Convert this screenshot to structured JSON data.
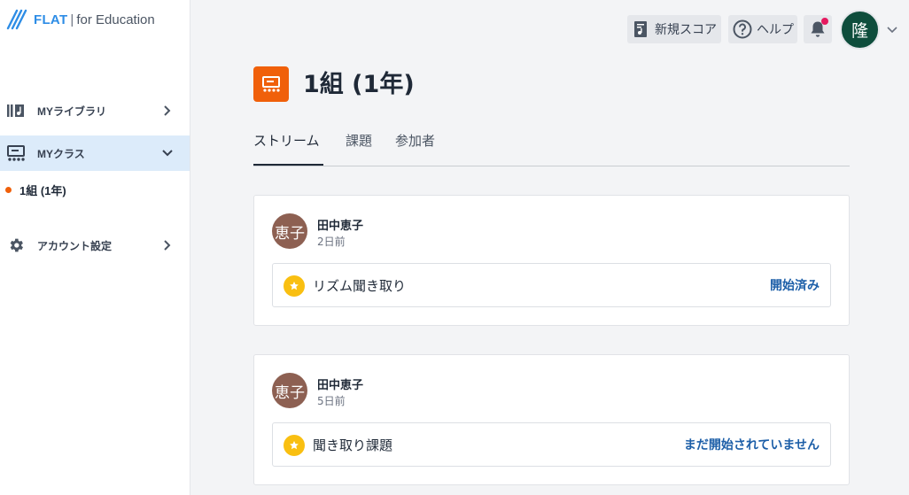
{
  "brand": {
    "name": "FLAT",
    "separator": "|",
    "product": "for Education",
    "color": "#2e8de6"
  },
  "sidebar": {
    "items": [
      {
        "label": "MYライブラリ",
        "icon": "library-icon",
        "chevron": "chevron-right-icon"
      },
      {
        "label": "MYクラス",
        "icon": "class-icon",
        "chevron": "chevron-down-icon",
        "active": true
      },
      {
        "label": "アカウント設定",
        "icon": "gear-icon",
        "chevron": "chevron-right-icon"
      }
    ],
    "class_list": [
      {
        "label": "1組 (1年)",
        "dot_color": "#f0600a"
      }
    ]
  },
  "topbar": {
    "new_score_label": "新規スコア",
    "help_label": "ヘルプ",
    "notification_badge_color": "#e5195f",
    "user_avatar_text": "隆",
    "user_avatar_color": "#0e4d3c"
  },
  "class_header": {
    "title": "1組 (1年)",
    "icon_color": "#f0600a"
  },
  "tabs": [
    {
      "label": "ストリーム",
      "active": true
    },
    {
      "label": "課題",
      "active": false
    },
    {
      "label": "参加者",
      "active": false
    }
  ],
  "posts": [
    {
      "author": "田中恵子",
      "avatar_text": "恵子",
      "time": "2日前",
      "assignment": {
        "title": "リズム聞き取り",
        "status": "開始済み"
      }
    },
    {
      "author": "田中恵子",
      "avatar_text": "恵子",
      "time": "5日前",
      "assignment": {
        "title": "聞き取り課題",
        "status": "まだ開始されていません"
      }
    }
  ]
}
